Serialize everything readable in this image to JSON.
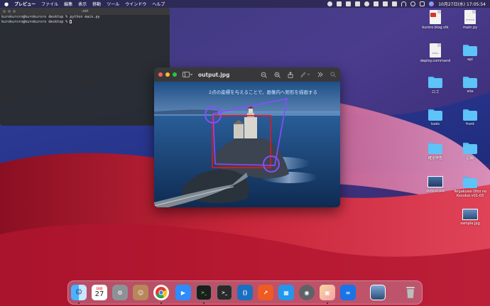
{
  "menubar": {
    "app_name": "プレビュー",
    "items": [
      "ファイル",
      "編集",
      "表示",
      "移動",
      "ツール",
      "ウインドウ",
      "ヘルプ"
    ],
    "clock": "10月27日(水) 17:05:54"
  },
  "terminal": {
    "title": "-zsh",
    "lines": [
      "kurokuroro@kurokuroro desktop % python main.py",
      "kurokuroro@kurokuroro desktop % "
    ]
  },
  "preview": {
    "title": "output.jpg",
    "caption": "2点の座標を与えることで、画像内へ矩形を描画する"
  },
  "desktop_icons": [
    {
      "label": "kuroro.blog.stk",
      "kind": "file",
      "tag": ""
    },
    {
      "label": "main.py",
      "kind": "file",
      "tag": "PYTHON"
    },
    {
      "label": "deploy.command",
      "kind": "file",
      "tag": "SHELL"
    },
    {
      "label": "api",
      "kind": "folder"
    },
    {
      "label": "ロゴ",
      "kind": "folder"
    },
    {
      "label": "site",
      "kind": "folder"
    },
    {
      "label": "tools",
      "kind": "folder"
    },
    {
      "label": "front",
      "kind": "folder"
    },
    {
      "label": "確定申告",
      "kind": "folder"
    },
    {
      "label": "記録",
      "kind": "folder"
    },
    {
      "label": "output.jpg",
      "kind": "image"
    },
    {
      "label": "Teigakusei Otto no Kozukai v01-03",
      "kind": "folder"
    },
    {
      "label": "sample.jpg",
      "kind": "image"
    }
  ],
  "dock": {
    "calendar_month": "10月",
    "calendar_day": "27"
  },
  "colors": {
    "folder": "#5ec3f7",
    "rect": "#e8151b",
    "circle": "#8a4cff"
  }
}
